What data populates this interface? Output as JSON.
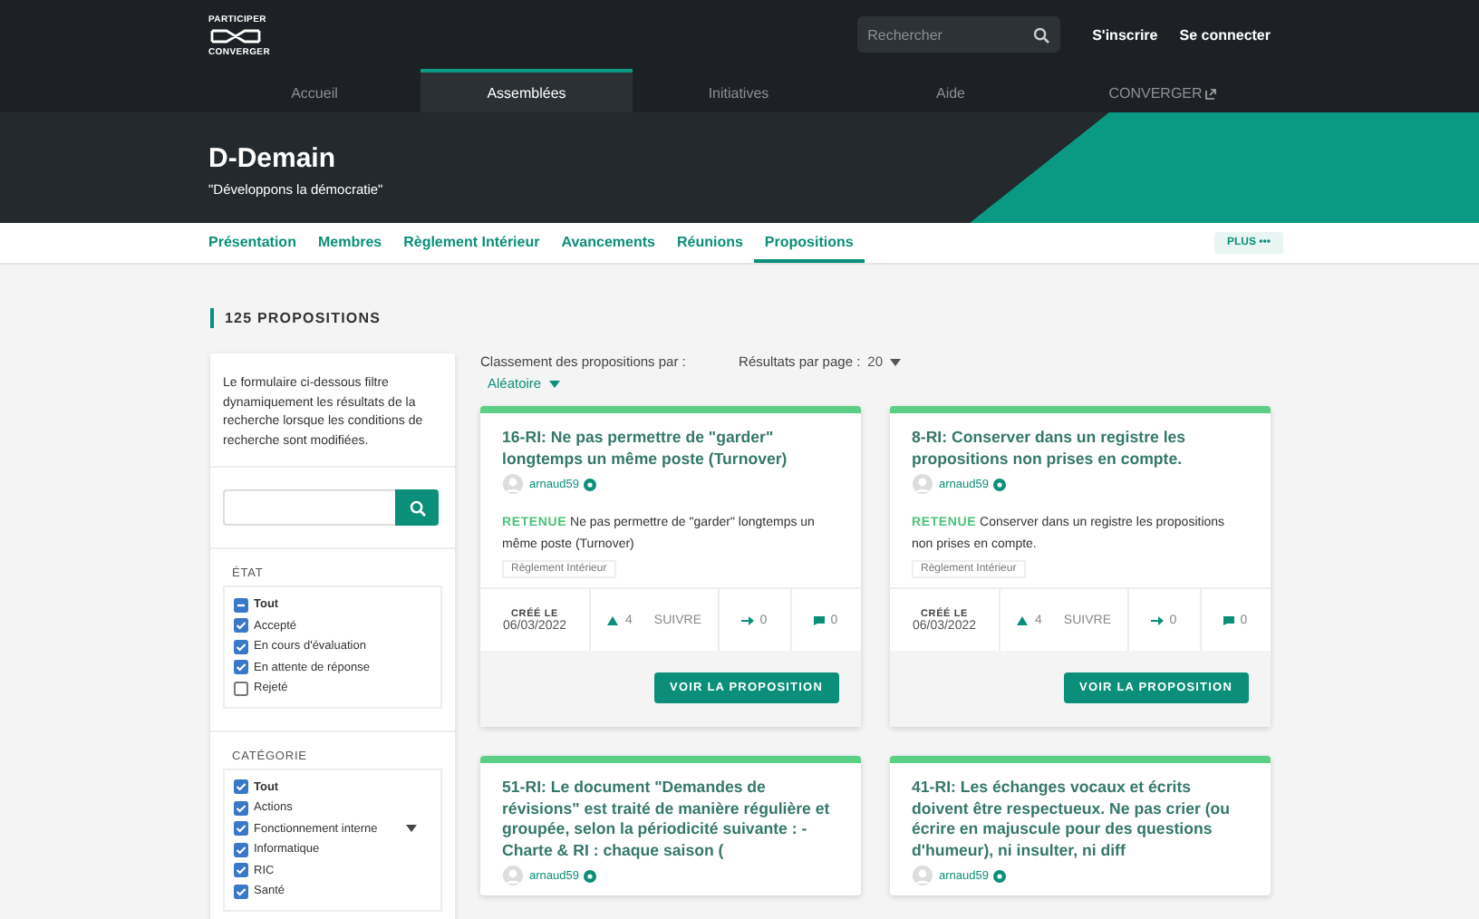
{
  "header": {
    "logo_top": "PARTICIPER",
    "logo_bottom": "CONVERGER",
    "search": {
      "placeholder": "Rechercher"
    },
    "links": [
      "S'inscrire",
      "Se connecter"
    ]
  },
  "nav": [
    {
      "label": "Accueil",
      "selected": false,
      "external": false
    },
    {
      "label": "Assemblées",
      "selected": true,
      "external": false
    },
    {
      "label": "Initiatives",
      "selected": false,
      "external": false
    },
    {
      "label": "Aide",
      "selected": false,
      "external": false
    },
    {
      "label": "CONVERGER",
      "selected": false,
      "external": true
    }
  ],
  "hero": {
    "title": "D-Demain",
    "subtitle": "\"Développons la démocratie\""
  },
  "subnav": {
    "items": [
      {
        "label": "Présentation",
        "selected": false
      },
      {
        "label": "Membres",
        "selected": false
      },
      {
        "label": "Règlement Intérieur",
        "selected": false
      },
      {
        "label": "Avancements",
        "selected": false
      },
      {
        "label": "Réunions",
        "selected": false
      },
      {
        "label": "Propositions",
        "selected": true
      }
    ],
    "more": "PLUS •••"
  },
  "count": "125 PROPOSITIONS",
  "filters": {
    "intro": "Le formulaire ci-dessous filtre dynamiquement les résultats de la recherche lorsque les conditions de recherche sont modifiées.",
    "groups": [
      {
        "title": "ÉTAT",
        "options": [
          {
            "label": "Tout",
            "checked": true,
            "indeterminate": true,
            "expandable": false
          },
          {
            "label": "Accepté",
            "checked": true,
            "indeterminate": false,
            "expandable": false
          },
          {
            "label": "En cours d'évaluation",
            "checked": true,
            "indeterminate": false,
            "expandable": false
          },
          {
            "label": "En attente de réponse",
            "checked": true,
            "indeterminate": false,
            "expandable": false
          },
          {
            "label": "Rejeté",
            "checked": false,
            "indeterminate": false,
            "expandable": false
          }
        ]
      },
      {
        "title": "CATÉGORIE",
        "options": [
          {
            "label": "Tout",
            "checked": true,
            "indeterminate": false,
            "expandable": false
          },
          {
            "label": "Actions",
            "checked": true,
            "indeterminate": false,
            "expandable": false
          },
          {
            "label": "Fonctionnement interne",
            "checked": true,
            "indeterminate": false,
            "expandable": true
          },
          {
            "label": "Informatique",
            "checked": true,
            "indeterminate": false,
            "expandable": false
          },
          {
            "label": "RIC",
            "checked": true,
            "indeterminate": false,
            "expandable": false
          },
          {
            "label": "Santé",
            "checked": true,
            "indeterminate": false,
            "expandable": false
          }
        ]
      }
    ]
  },
  "sort": {
    "label": "Classement des propositions par :",
    "value": "Aléatoire"
  },
  "per_page": {
    "label": "Résultats par page :",
    "value": "20"
  },
  "proposals": [
    {
      "title": "16-RI: Ne pas permettre de \"garder\" longtemps un même poste (Turnover)",
      "author": "arnaud59",
      "verified": true,
      "status": "RETENUE",
      "summary": "Ne pas permettre de \"garder\" longtemps un même poste (Turnover)",
      "tag": "Règlement Intérieur",
      "created_label": "CRÉÉ LE",
      "created": "06/03/2022",
      "supports": "4",
      "follow": "SUIVRE",
      "endorsements": "0",
      "comments": "0",
      "action": "VOIR LA PROPOSITION"
    },
    {
      "title": "8-RI: Conserver dans un registre les propositions non prises en compte.",
      "author": "arnaud59",
      "verified": true,
      "status": "RETENUE",
      "summary": "Conserver dans un registre les propositions non prises en compte.",
      "tag": "Règlement Intérieur",
      "created_label": "CRÉÉ LE",
      "created": "06/03/2022",
      "supports": "4",
      "follow": "SUIVRE",
      "endorsements": "0",
      "comments": "0",
      "action": "VOIR LA PROPOSITION"
    },
    {
      "title": "51-RI: Le document \"Demandes de révisions\" est traité de manière régulière et groupée, selon la périodicité suivante : - Charte & RI : chaque saison (",
      "author": "arnaud59",
      "verified": true
    },
    {
      "title": "41-RI: Les échanges vocaux et écrits doivent être respectueux. Ne pas crier (ou écrire en majuscule pour des questions d'humeur), ni insulter, ni diff",
      "author": "arnaud59",
      "verified": true
    }
  ]
}
